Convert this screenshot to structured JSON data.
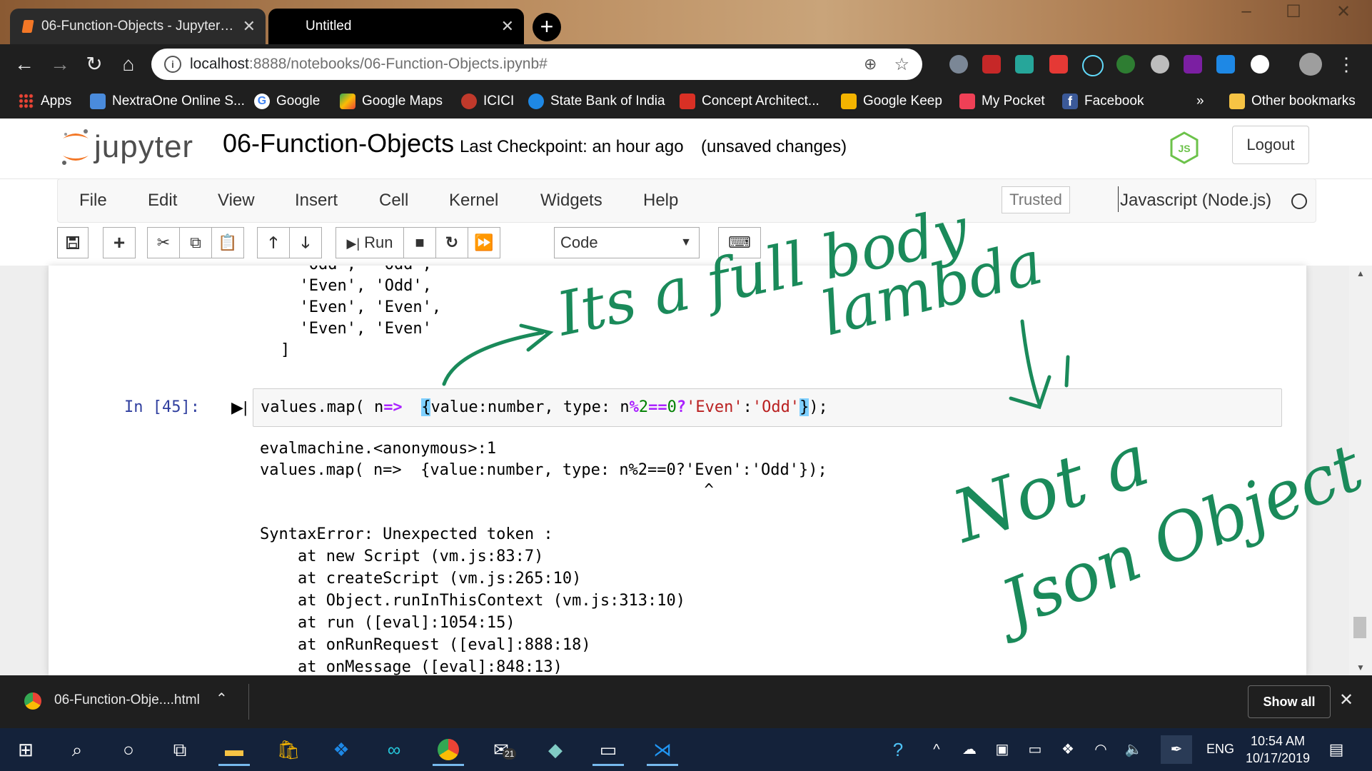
{
  "browser": {
    "tabs": [
      {
        "label": "06-Function-Objects - Jupyter Notebook"
      },
      {
        "label": "Untitled"
      }
    ],
    "address": {
      "host": "localhost",
      "path": ":8888/notebooks/06-Function-Objects.ipynb#"
    },
    "bookmarks": [
      {
        "label": "Apps",
        "icon": "apps-grid-icon",
        "color": "#ea4335"
      },
      {
        "label": "NextraOne Online S...",
        "icon": "nextraone-icon",
        "color": "#4a8bdc"
      },
      {
        "label": "Google",
        "icon": "google-icon",
        "color": "#ffffff"
      },
      {
        "label": "Google Maps",
        "icon": "maps-icon",
        "color": "#34a853"
      },
      {
        "label": "ICICI",
        "icon": "icici-icon",
        "color": "#c0392b"
      },
      {
        "label": "State Bank of India",
        "icon": "sbi-icon",
        "color": "#1e88e5"
      },
      {
        "label": "Concept Architect...",
        "icon": "mail-icon",
        "color": "#d93025"
      },
      {
        "label": "Google Keep",
        "icon": "keep-icon",
        "color": "#f4b400"
      },
      {
        "label": "My Pocket",
        "icon": "pocket-icon",
        "color": "#ef4056"
      },
      {
        "label": "Facebook",
        "icon": "facebook-icon",
        "color": "#3b5998"
      },
      {
        "label": "»",
        "icon": "",
        "color": ""
      },
      {
        "label": "Other bookmarks",
        "icon": "folder-icon",
        "color": "#f6c344"
      }
    ]
  },
  "jupyter": {
    "logo_text": "jupyter",
    "notebook_name": "06-Function-Objects",
    "checkpoint": "Last Checkpoint: an hour ago",
    "status": "(unsaved changes)",
    "logout": "Logout",
    "menus": [
      "File",
      "Edit",
      "View",
      "Insert",
      "Cell",
      "Kernel",
      "Widgets",
      "Help"
    ],
    "trusted": "Trusted",
    "kernel": "Javascript (Node.js)",
    "run_label": "Run",
    "cell_type": "Code"
  },
  "notebook": {
    "prev_output": [
      "  'Odd',  'Odd',",
      "  'Even', 'Odd',",
      "  'Even', 'Even',",
      "  'Even', 'Even'",
      "]"
    ],
    "prompt": "In [45]:",
    "code": {
      "a": "values.map( n",
      "arrow": "=>",
      "b": "  ",
      "brace_open": "{",
      "c": "value:number, type: n",
      "mod": "%",
      "two": "2",
      "eq": "==",
      "zero": "0",
      "q": "?",
      "even": "'Even'",
      "colon": ":",
      "odd": "'Odd'",
      "brace_close": "}",
      "end": ");"
    },
    "error_output": [
      "evalmachine.<anonymous>:1",
      "values.map( n=>  {value:number, type: n%2==0?'Even':'Odd'});",
      "                                               ^",
      "",
      "SyntaxError: Unexpected token :",
      "    at new Script (vm.js:83:7)",
      "    at createScript (vm.js:265:10)",
      "    at Object.runInThisContext (vm.js:313:10)",
      "    at run ([eval]:1054:15)",
      "    at onRunRequest ([eval]:888:18)",
      "    at onMessage ([eval]:848:13)"
    ]
  },
  "annotations": {
    "color": "#1a8a5a",
    "note1_line1": "Its a full body",
    "note1_line2": "lambda",
    "note2_line1": "Not a",
    "note2_line2": "Json Object"
  },
  "downloads": {
    "file": "06-Function-Obje....html",
    "show_all": "Show all"
  },
  "taskbar": {
    "lang": "ENG",
    "time": "10:54 AM",
    "date": "10/17/2019",
    "mail_badge": "21"
  }
}
